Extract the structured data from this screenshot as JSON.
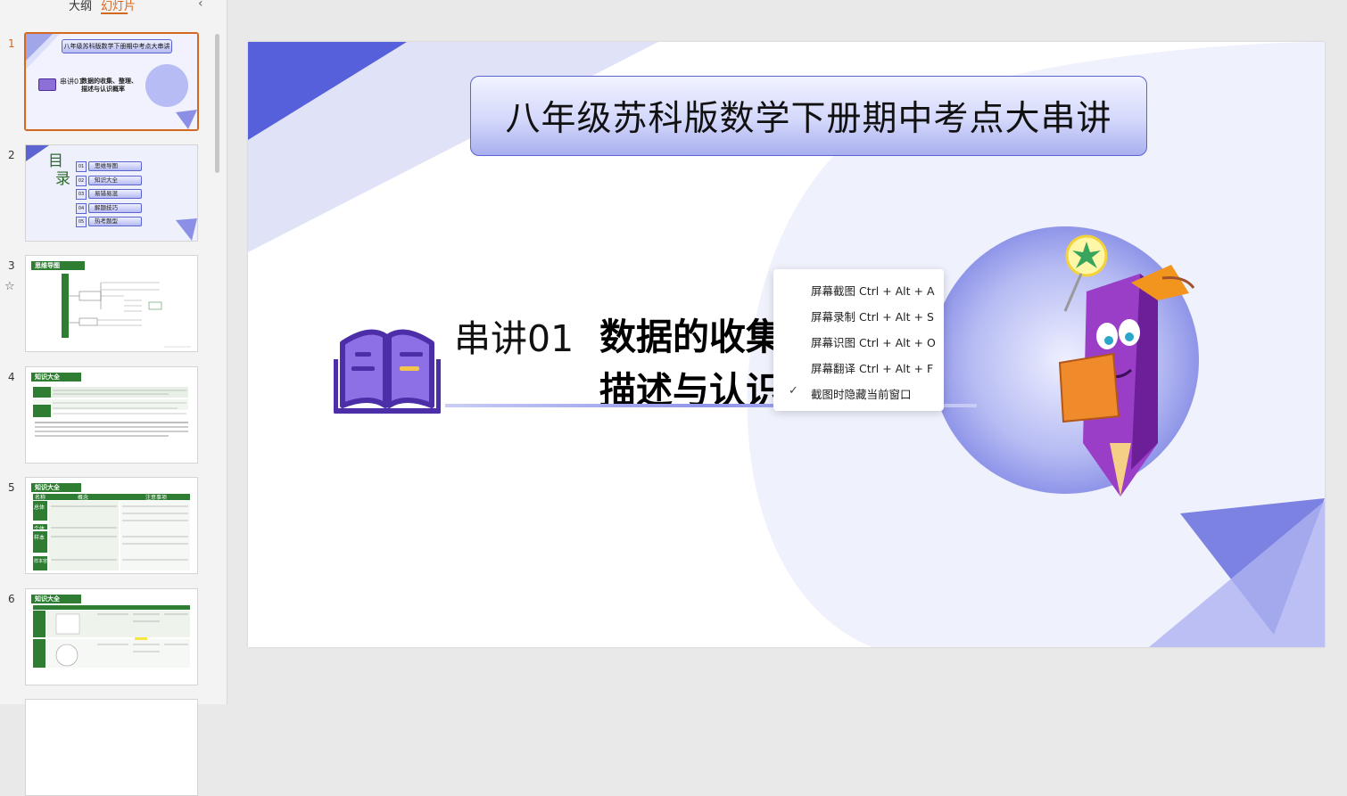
{
  "sidebar": {
    "tabs": {
      "outline": "大纲",
      "slides": "幻灯片"
    },
    "collapse_icon": "chevron-left-icon",
    "slide_numbers": [
      "1",
      "2",
      "3",
      "4",
      "5",
      "6"
    ],
    "thumb2": {
      "heading_1": "目",
      "heading_2": "录",
      "items": [
        {
          "num": "01",
          "label": "思维导图"
        },
        {
          "num": "02",
          "label": "知识大全"
        },
        {
          "num": "03",
          "label": "易错易混"
        },
        {
          "num": "04",
          "label": "解题技巧"
        },
        {
          "num": "05",
          "label": "热考题型"
        }
      ]
    },
    "thumb3_header": "思维导图",
    "thumb4_header": "知识大全",
    "thumb5_header": "知识大全",
    "thumb6_header": "知识大全",
    "thumb5_cols": [
      "名称",
      "概念",
      "注意事项"
    ],
    "thumb5_rows": [
      "总体",
      "个体",
      "样本",
      "样本容量"
    ]
  },
  "slide": {
    "title": "八年级苏科版数学下册期中考点大串讲",
    "lecture_label": "串讲01",
    "lecture_title_line1": "数据的收集、整理、",
    "lecture_title_line2": "描述与认识概率",
    "book_icon": "open-book-icon",
    "mascot": "pencil-wizard-mascot"
  },
  "thumb1": {
    "title": "八年级苏科版数学下册期中考点大串讲",
    "label": "串讲01",
    "subtitle_1": "数据的收集、整理、",
    "subtitle_2": "描述与认识概率"
  },
  "context_menu": {
    "items": [
      "屏幕截图 Ctrl + Alt + A",
      "屏幕录制 Ctrl + Alt + S",
      "屏幕识图 Ctrl + Alt + O",
      "屏幕翻译 Ctrl + Alt + F"
    ],
    "checked_option": "截图时隐藏当前窗口"
  },
  "colors": {
    "accent": "#d4681f",
    "slide_blue": "#5b64d0",
    "slide_light": "#eef0fc",
    "green": "#2e7d32"
  }
}
